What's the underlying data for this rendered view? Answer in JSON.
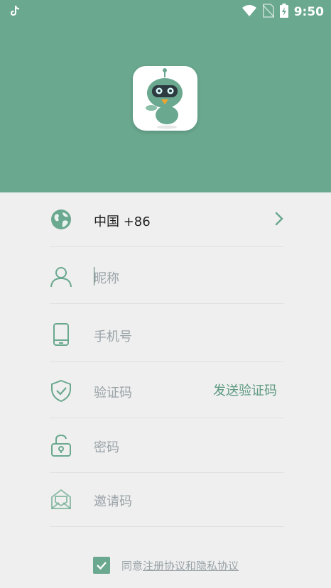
{
  "status_bar": {
    "time": "9:50",
    "left_icon": "tiktok-icon",
    "icons": [
      "wifi-icon",
      "no-sim-icon",
      "battery-charging-icon"
    ]
  },
  "app_logo": {
    "icon": "robot-mascot-icon"
  },
  "form": {
    "country": {
      "icon": "globe-icon",
      "value": "中国 +86",
      "chevron": "chevron-right-icon"
    },
    "nickname": {
      "icon": "user-icon",
      "placeholder": "昵称"
    },
    "phone": {
      "icon": "phone-icon",
      "placeholder": "手机号"
    },
    "verification": {
      "icon": "shield-check-icon",
      "placeholder": "验证码",
      "send_button": "发送验证码"
    },
    "password": {
      "icon": "unlock-icon",
      "placeholder": "密码"
    },
    "invite": {
      "icon": "envelope-open-icon",
      "placeholder": "邀请码"
    }
  },
  "agreement": {
    "checked": true,
    "prefix": "同意",
    "link1": "注册协议",
    "middle": "和",
    "link2": "隐私协议"
  },
  "colors": {
    "accent": "#6aa88f",
    "background": "#efefef",
    "placeholder": "#9aa3a8"
  }
}
